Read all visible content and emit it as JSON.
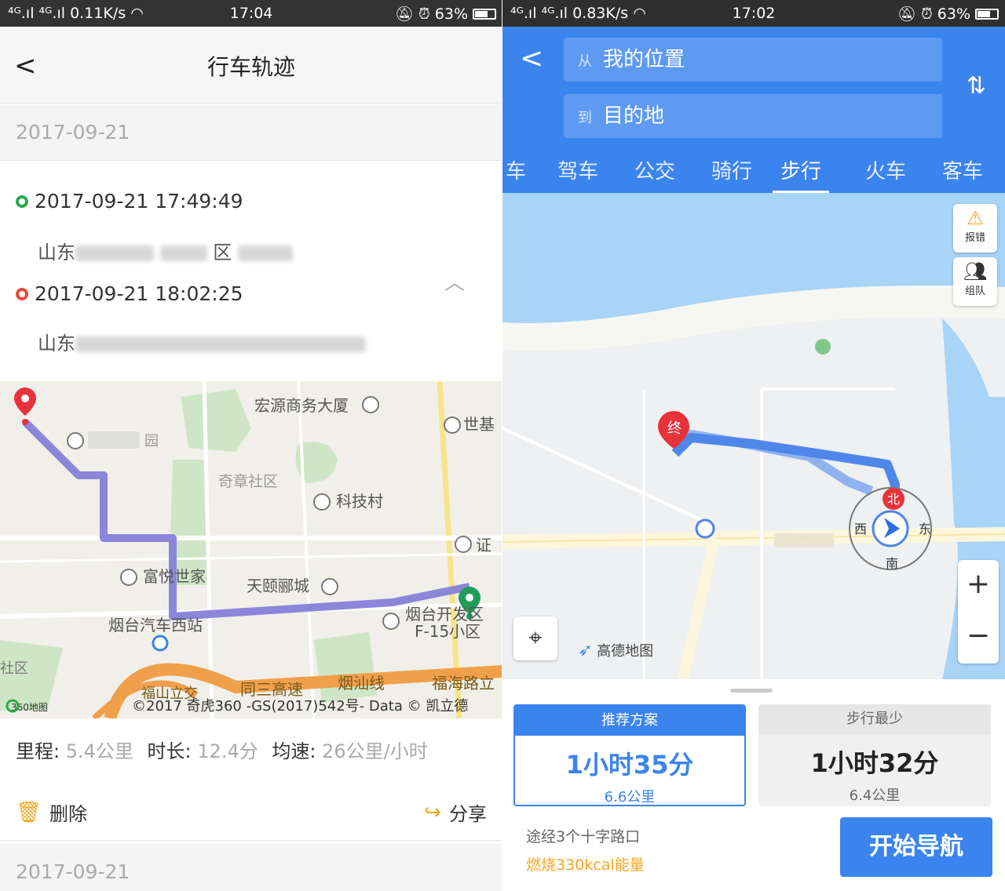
{
  "left_screen": {
    "status": {
      "signal": "⁴ᴳ.ıl ⁴ᴳ.ıl",
      "speed": "0.11K/s",
      "time": "17:04",
      "battery": "63%"
    },
    "title": "行车轨迹",
    "date": "2017-09-21",
    "start": {
      "time": "2017-09-21 17:49:49",
      "address_visible": "山东",
      "address_mid": "区"
    },
    "end": {
      "time": "2017-09-21 18:02:25",
      "address_visible": "山东"
    },
    "map_labels": {
      "hongyuan": "宏源商务大厦",
      "shiji": "世基",
      "qizhang": "奇章社区",
      "keji": "科技村",
      "zheng": "证",
      "fuyu": "富悦世家",
      "tianyi": "天颐郦城",
      "kaifa": "烟台开发区",
      "f15": "F-15小区",
      "qiche": "烟台汽车西站",
      "tongsan": "同三高速",
      "yanshan": "烟汕线",
      "fuhai": "福海路立",
      "fushan": "福山立交",
      "shequ": "社区",
      "yuan": "园",
      "copyright": "©2017 奇虎360 -GS(2017)542号- Data © 凯立德",
      "logo360": "360地图"
    },
    "stats": {
      "dist_label": "里程:",
      "dist": "5.4公里",
      "dur_label": "时长:",
      "dur": "12.4分",
      "speed_label": "均速:",
      "speed": "26公里/小时"
    },
    "delete": "删除",
    "share": "分享",
    "date2": "2017-09-21"
  },
  "right_screen": {
    "status": {
      "signal": "⁴ᴳ.ıl ⁴ᴳ.ıl",
      "speed": "0.83K/s",
      "time": "17:02",
      "battery": "63%"
    },
    "from_prefix": "从",
    "from": "我的位置",
    "to_prefix": "到",
    "to": "目的地",
    "tabs": [
      "车",
      "驾车",
      "公交",
      "骑行",
      "步行",
      "火车",
      "客车"
    ],
    "active_tab": "步行",
    "report": "报错",
    "team": "组队",
    "end_marker": "终",
    "north": "北",
    "compass": {
      "w": "西",
      "e": "东",
      "s": "南"
    },
    "brand": "高德地图",
    "plan1": {
      "header": "推荐方案",
      "time": "1小时35分",
      "dist": "6.6公里"
    },
    "plan2": {
      "header": "步行最少",
      "time": "1小时32分",
      "dist": "6.4公里"
    },
    "via": "途经3个十字路口",
    "burn": "燃烧330kcal能量",
    "start_nav": "开始导航"
  }
}
